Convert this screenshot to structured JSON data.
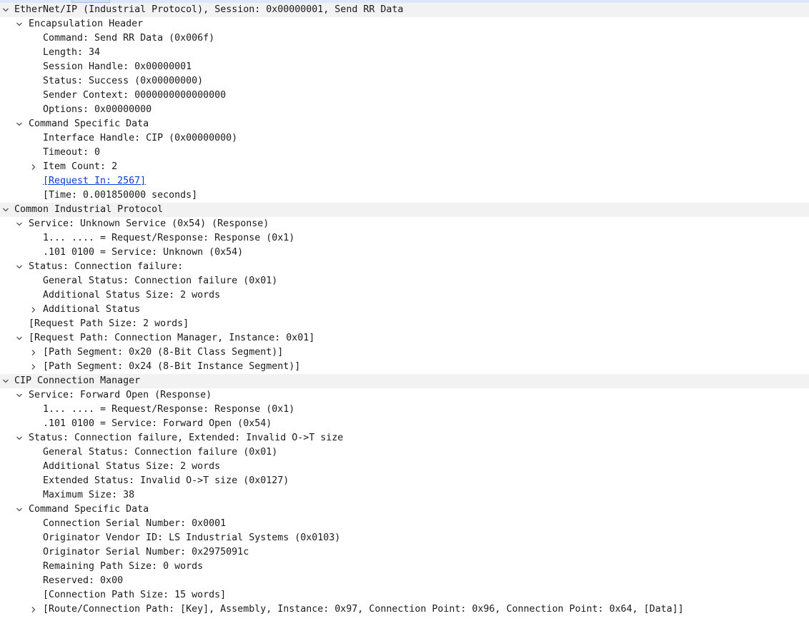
{
  "colors": {
    "section_background": "#f2f2f2",
    "link": "#0a3fd8",
    "text": "#1a1a1a",
    "top_strip": "#dbe8f7"
  },
  "tree": {
    "r0": "EtherNet/IP (Industrial Protocol), Session: 0x00000001, Send RR Data",
    "r1": "Encapsulation Header",
    "r2": "Command: Send RR Data (0x006f)",
    "r3": "Length: 34",
    "r4": "Session Handle: 0x00000001",
    "r5": "Status: Success (0x00000000)",
    "r6": "Sender Context: 0000000000000000",
    "r7": "Options: 0x00000000",
    "r8": "Command Specific Data",
    "r9": "Interface Handle: CIP (0x00000000)",
    "r10": "Timeout: 0",
    "r11": "Item Count: 2",
    "r12": "[Request In: 2567]",
    "r13": "[Time: 0.001850000 seconds]",
    "r14": "Common Industrial Protocol",
    "r15": "Service: Unknown Service (0x54) (Response)",
    "r16": "1... .... = Request/Response: Response (0x1)",
    "r17": ".101 0100 = Service: Unknown (0x54)",
    "r18": "Status: Connection failure:",
    "r19": "General Status: Connection failure (0x01)",
    "r20": "Additional Status Size: 2 words",
    "r21": "Additional Status",
    "r22": "[Request Path Size: 2 words]",
    "r23": "[Request Path: Connection Manager, Instance: 0x01]",
    "r24": "[Path Segment: 0x20 (8-Bit Class Segment)]",
    "r25": "[Path Segment: 0x24 (8-Bit Instance Segment)]",
    "r26": "CIP Connection Manager",
    "r27": "Service: Forward Open (Response)",
    "r28": "1... .... = Request/Response: Response (0x1)",
    "r29": ".101 0100 = Service: Forward Open (0x54)",
    "r30": "Status: Connection failure, Extended: Invalid O->T size",
    "r31": "General Status: Connection failure (0x01)",
    "r32": "Additional Status Size: 2 words",
    "r33": "Extended Status: Invalid O->T size (0x0127)",
    "r34": "Maximum Size: 38",
    "r35": "Command Specific Data",
    "r36": "Connection Serial Number: 0x0001",
    "r37": "Originator Vendor ID: LS Industrial Systems (0x0103)",
    "r38": "Originator Serial Number: 0x2975091c",
    "r39": "Remaining Path Size: 0 words",
    "r40": "Reserved: 0x00",
    "r41": "[Connection Path Size: 15 words]",
    "r42": "[Route/Connection Path: [Key], Assembly, Instance: 0x97, Connection Point: 0x96, Connection Point: 0x64, [Data]]"
  }
}
